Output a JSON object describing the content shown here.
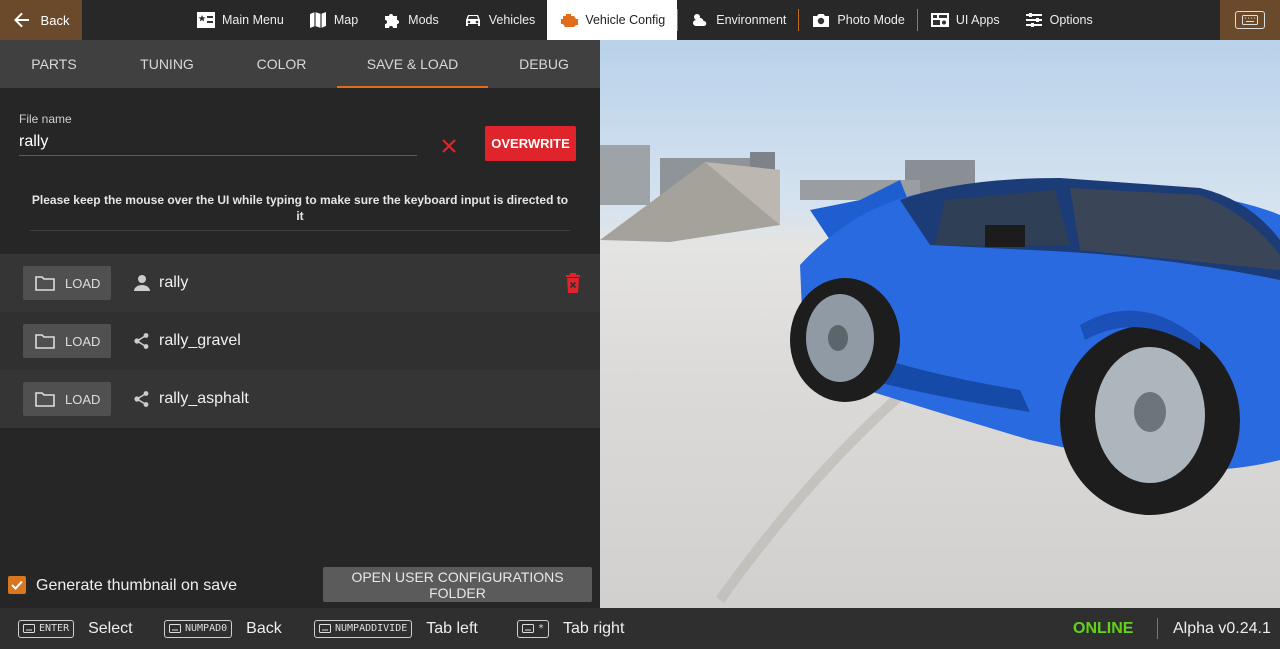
{
  "topbar": {
    "back_label": "Back",
    "nav": [
      {
        "label": "Main Menu",
        "icon": "main-menu-icon"
      },
      {
        "label": "Map",
        "icon": "map-icon"
      },
      {
        "label": "Mods",
        "icon": "puzzle-icon"
      },
      {
        "label": "Vehicles",
        "icon": "car-icon"
      },
      {
        "label": "Vehicle Config",
        "icon": "engine-icon",
        "active": true
      },
      {
        "label": "Environment",
        "icon": "weather-icon"
      },
      {
        "label": "Photo Mode",
        "icon": "camera-icon"
      },
      {
        "label": "UI Apps",
        "icon": "ui-apps-icon"
      },
      {
        "label": "Options",
        "icon": "sliders-icon"
      }
    ],
    "accent_color": "#e26c1a"
  },
  "tabs": [
    {
      "label": "PARTS"
    },
    {
      "label": "TUNING"
    },
    {
      "label": "COLOR"
    },
    {
      "label": "SAVE & LOAD",
      "active": true
    },
    {
      "label": "DEBUG"
    }
  ],
  "file": {
    "label": "File name",
    "value": "rally",
    "overwrite_label": "OVERWRITE",
    "hint": "Please keep the mouse over the UI while typing to make sure the keyboard input is directed to it"
  },
  "configs": [
    {
      "load_label": "LOAD",
      "name": "rally",
      "source_icon": "user-icon",
      "deletable": true
    },
    {
      "load_label": "LOAD",
      "name": "rally_gravel",
      "source_icon": "share-nodes-icon",
      "deletable": false
    },
    {
      "load_label": "LOAD",
      "name": "rally_asphalt",
      "source_icon": "share-nodes-icon",
      "deletable": false
    }
  ],
  "thumbnail": {
    "label": "Generate thumbnail on save",
    "checked": true
  },
  "open_folder_label": "OPEN USER CONFIGURATIONS FOLDER",
  "bottombar": {
    "hints": [
      {
        "key": "ENTER",
        "action": "Select"
      },
      {
        "key": "NUMPAD0",
        "action": "Back"
      },
      {
        "key": "NUMPADDIVIDE",
        "action": "Tab left"
      },
      {
        "key": "*",
        "action": "Tab right"
      }
    ],
    "status": "ONLINE",
    "version": "Alpha v0.24.1"
  },
  "colors": {
    "overwrite": "#e0242c",
    "online": "#63d21b",
    "delete": "#e0242c",
    "checkbox": "#d9761e"
  }
}
